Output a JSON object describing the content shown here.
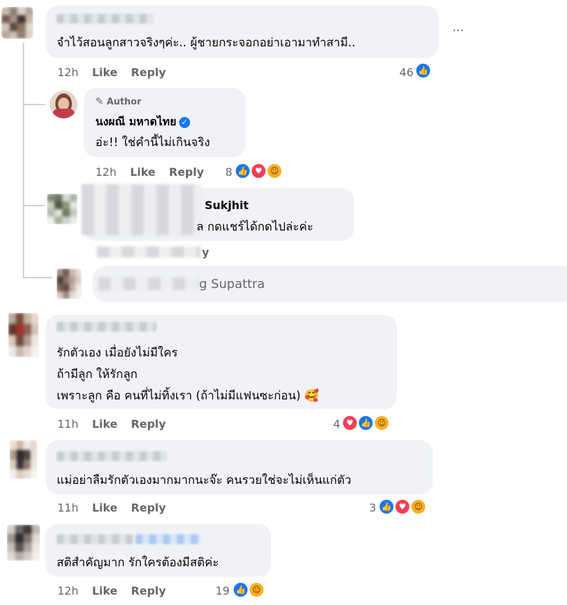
{
  "colors": {
    "like": "#1877f2",
    "love": "#f33e58",
    "care": "#f7b125",
    "bubble": "#f0f2f5",
    "meta": "#65676b"
  },
  "comments": [
    {
      "text": "จำไว้สอนลูกสาวจริงๆค่ะ.. ผู้ชายกระจอกอย่าเอามาทำสามี..",
      "time": "12h",
      "like": "Like",
      "reply": "Reply",
      "count": "46",
      "more": "···"
    },
    {
      "author_tag": "Author",
      "name": "นงผณี มหาดไทย",
      "text": "อ่ะ!! ใช่คำนี้ไม่เกินจริง",
      "time": "12h",
      "like": "Like",
      "reply": "Reply",
      "count": "8"
    },
    {
      "name_suffix": "Sukjhit",
      "text_suffix": "ล กดแชร์ได้กดไปล่ะค่ะ",
      "meta_fragment": "y"
    },
    {
      "input_suffix": "g Supattra"
    },
    {
      "lines": [
        "รักตัวเอง เมื่อยังไม่มีใคร",
        "ถ้ามีลูก ให้รักลูก",
        "เพราะลูก คือ คนที่ไม่ทิ้งเรา (ถ้าไม่มีแฟนซะก่อน) 🥰"
      ],
      "time": "11h",
      "like": "Like",
      "reply": "Reply",
      "count": "4"
    },
    {
      "text": "แม่อย่าลืมรักตัวเองมากมากนะจ๊ะ คนรวยใช่จะไม่เห็นแก่ตัว",
      "time": "11h",
      "like": "Like",
      "reply": "Reply",
      "count": "3"
    },
    {
      "text": "สติสำคัญมาก รักใครต้องมีสติค่ะ",
      "time": "12h",
      "like": "Like",
      "reply": "Reply",
      "count": "19"
    }
  ]
}
